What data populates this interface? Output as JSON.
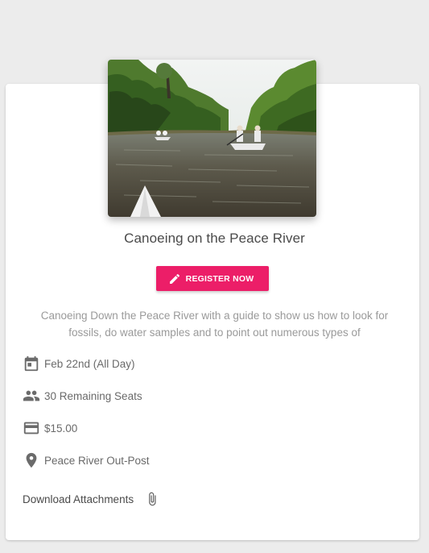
{
  "event": {
    "title": "Canoeing on the Peace River",
    "description": "Canoeing Down the Peace River with a guide to show us how to look for fossils, do water samples and to point out numerous types of",
    "register_label": "REGISTER NOW",
    "date": "Feb 22nd (All Day)",
    "seats": "30 Remaining Seats",
    "price": "$15.00",
    "location": "Peace River Out-Post",
    "attachments_label": "Download Attachments"
  },
  "icons": {
    "register": "pencil-icon",
    "date": "calendar-icon",
    "seats": "people-icon",
    "price": "credit-card-icon",
    "location": "location-pin-icon",
    "attachments": "paperclip-icon"
  },
  "colors": {
    "accent": "#ec1e68",
    "icon": "#6b6b6b",
    "background": "#ececec"
  }
}
